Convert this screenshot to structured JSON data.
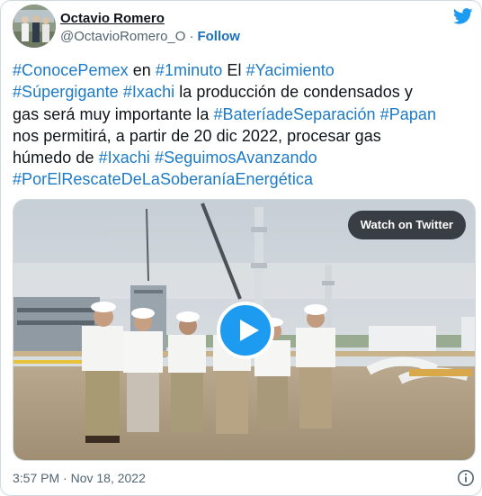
{
  "author": {
    "name": "Octavio Romero",
    "handle": "@OctavioRomero_O",
    "separator": "·",
    "follow_label": "Follow"
  },
  "tweet": {
    "lines": [
      [
        {
          "t": "#ConocePemex",
          "tag": true
        },
        {
          "t": " en ",
          "tag": false
        },
        {
          "t": "#1minuto",
          "tag": true
        },
        {
          "t": "  El ",
          "tag": false
        },
        {
          "t": "#Yacimiento",
          "tag": true
        }
      ],
      [
        {
          "t": "#Súpergigante",
          "tag": true
        },
        {
          "t": "  ",
          "tag": false
        },
        {
          "t": "#Ixachi",
          "tag": true
        },
        {
          "t": " la producción de condensados y",
          "tag": false
        }
      ],
      [
        {
          "t": "gas será muy importante la ",
          "tag": false
        },
        {
          "t": "#BateríadeSeparación",
          "tag": true
        },
        {
          "t": " ",
          "tag": false
        },
        {
          "t": "#Papan",
          "tag": true
        }
      ],
      [
        {
          "t": "nos permitirá, a partir de 20 dic 2022, procesar gas",
          "tag": false
        }
      ],
      [
        {
          "t": "húmedo de ",
          "tag": false
        },
        {
          "t": "#Ixachi",
          "tag": true
        },
        {
          "t": " ",
          "tag": false
        },
        {
          "t": "#SeguimosAvanzando",
          "tag": true
        }
      ],
      [
        {
          "t": "#PorElRescateDeLaSoberaníaEnergética",
          "tag": true
        }
      ]
    ]
  },
  "media": {
    "watch_label": "Watch on Twitter"
  },
  "footer": {
    "timestamp": "3:57 PM · Nov 18, 2022"
  },
  "colors": {
    "link": "#1d7ac7",
    "twitter_blue": "#1d9bf0",
    "muted": "#536471"
  },
  "icons": {
    "brand": "twitter-bird-icon",
    "play": "play-icon",
    "info": "info-icon"
  }
}
